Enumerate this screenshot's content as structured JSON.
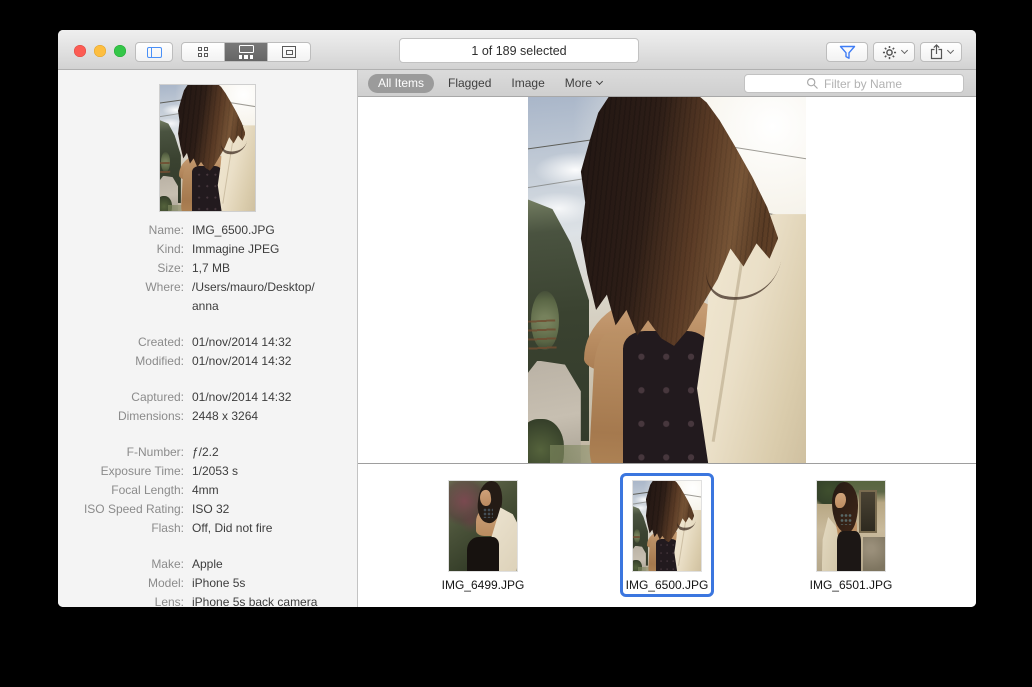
{
  "window": {
    "status_text": "1 of 189 selected"
  },
  "toolbar": {
    "icons": {
      "sidebar_toggle": "sidebar-toggle-icon",
      "grid_view": "grid-view-icon",
      "browser_view": "browser-view-icon",
      "slideshow_view": "slideshow-view-icon",
      "filter": "filter-funnel-icon",
      "actions": "gear-icon",
      "share": "share-icon"
    }
  },
  "filterbar": {
    "tabs": [
      {
        "label": "All Items",
        "selected": true
      },
      {
        "label": "Flagged",
        "selected": false
      },
      {
        "label": "Image",
        "selected": false
      }
    ],
    "more_label": "More",
    "search_placeholder": "Filter by Name"
  },
  "inspector": {
    "groups": [
      {
        "rows": [
          {
            "label": "Name:",
            "value": "IMG_6500.JPG"
          },
          {
            "label": "Kind:",
            "value": "Immagine JPEG"
          },
          {
            "label": "Size:",
            "value": "1,7 MB"
          },
          {
            "label": "Where:",
            "value": "/Users/mauro/Desktop/\nanna"
          }
        ]
      },
      {
        "rows": [
          {
            "label": "Created:",
            "value": "01/nov/2014 14:32"
          },
          {
            "label": "Modified:",
            "value": "01/nov/2014 14:32"
          }
        ]
      },
      {
        "rows": [
          {
            "label": "Captured:",
            "value": "01/nov/2014 14:32"
          },
          {
            "label": "Dimensions:",
            "value": "2448 x 3264"
          }
        ]
      },
      {
        "rows": [
          {
            "label": "F-Number:",
            "value": "ƒ/2.2"
          },
          {
            "label": "Exposure Time:",
            "value": "1/2053 s"
          },
          {
            "label": "Focal Length:",
            "value": "4mm"
          },
          {
            "label": "ISO Speed Rating:",
            "value": "ISO 32"
          },
          {
            "label": "Flash:",
            "value": "Off, Did not fire"
          }
        ]
      },
      {
        "rows": [
          {
            "label": "Make:",
            "value": "Apple"
          },
          {
            "label": "Model:",
            "value": "iPhone 5s"
          },
          {
            "label": "Lens:",
            "value": "iPhone 5s back camera"
          }
        ]
      }
    ]
  },
  "browser": {
    "items": [
      {
        "name": "IMG_6499.JPG",
        "selected": false
      },
      {
        "name": "IMG_6500.JPG",
        "selected": true
      },
      {
        "name": "IMG_6501.JPG",
        "selected": false
      }
    ]
  },
  "colors": {
    "selection_blue": "#3b76df",
    "selected_segment": "#6e6e6e",
    "selected_tab_pill": "#9b9b9b",
    "toolbar_icon_blue": "#4a90f7"
  }
}
